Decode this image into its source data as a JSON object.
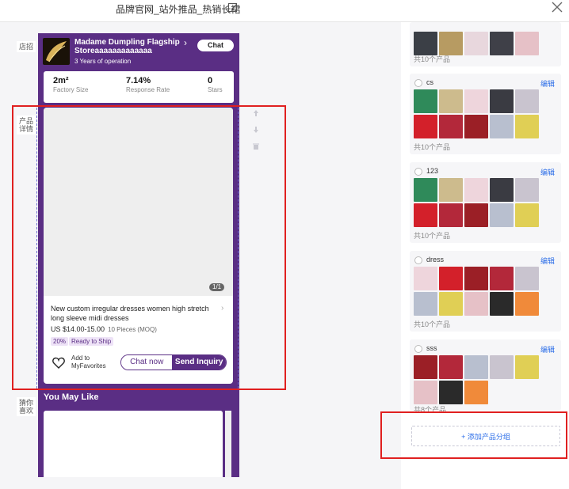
{
  "header": {
    "page_title": "品牌官网_站外推品_热销长裙"
  },
  "side_labels": {
    "shop_sign": "店招",
    "product_detail": "产品详情",
    "guess_you_like": "猜你喜欢"
  },
  "shop": {
    "name": "Madame Dumpling Flagship Storeaaaaaaaaaaaaa",
    "years": "3 Years of operation",
    "chat_label": "Chat",
    "stats": [
      {
        "value": "2m²",
        "label": "Factory Size"
      },
      {
        "value": "7.14%",
        "label": "Response Rate"
      },
      {
        "value": "0",
        "label": "Stars"
      }
    ]
  },
  "product": {
    "pager": "1/1",
    "title": "New custom irregular dresses women high stretch long sleeve midi dresses",
    "price": "US $14.00-15.00",
    "moq": "10 Pieces (MOQ)",
    "tags": [
      "20%",
      "Ready to Ship"
    ],
    "favorite_label": "Add to MyFavorites",
    "chat_now": "Chat now",
    "send_inquiry": "Send Inquiry"
  },
  "you_may_like": "You May Like",
  "groups": [
    {
      "name": "",
      "edit": "",
      "count": "共10个产品"
    },
    {
      "name": "cs",
      "edit": "编辑",
      "count": "共10个产品"
    },
    {
      "name": "123",
      "edit": "编辑",
      "count": "共10个产品"
    },
    {
      "name": "dress",
      "edit": "编辑",
      "count": "共10个产品"
    },
    {
      "name": "sss",
      "edit": "编辑",
      "count": "共8个产品"
    }
  ],
  "add_group_label": "+ 添加产品分组",
  "colors": {
    "brand_purple": "#5a2e84",
    "link_blue": "#2b6de8",
    "highlight_red": "#e02020"
  }
}
